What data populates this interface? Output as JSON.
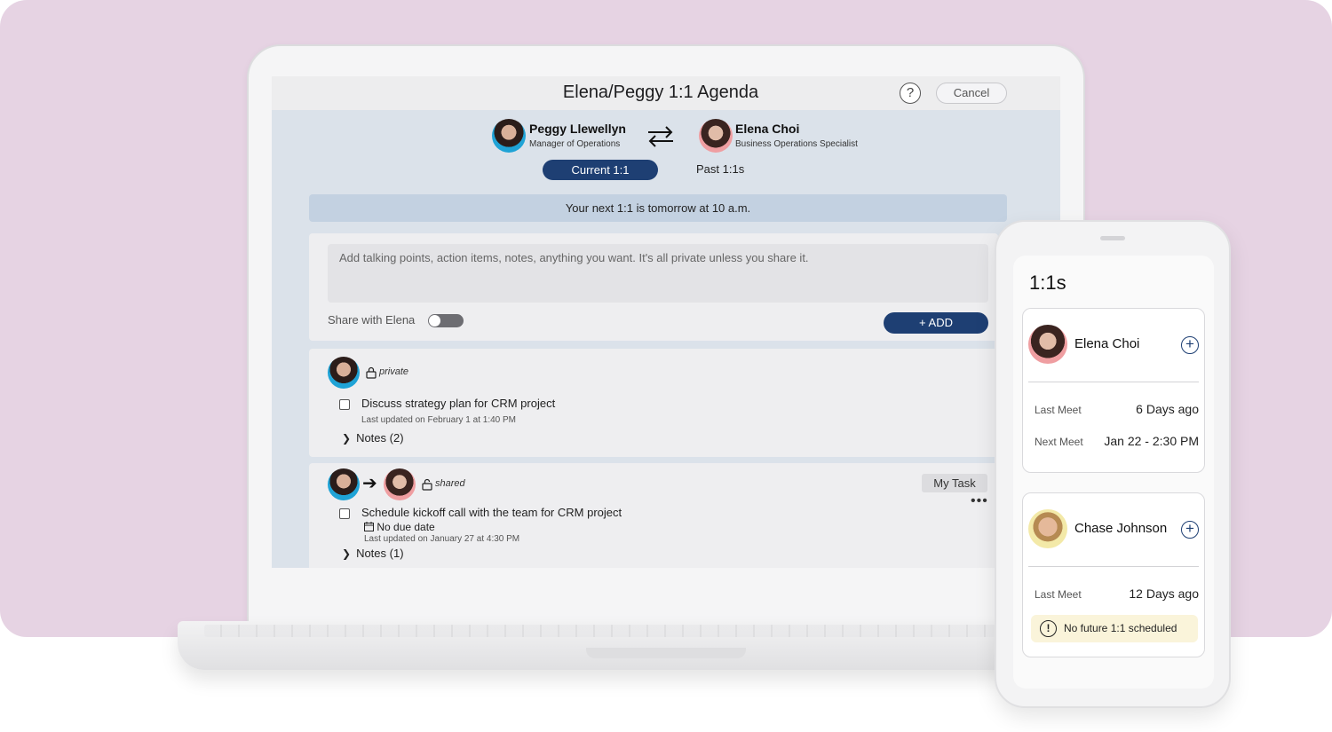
{
  "app": {
    "title": "Elena/Peggy 1:1 Agenda",
    "help_label": "?",
    "cancel_label": "Cancel"
  },
  "participants": {
    "manager": {
      "name": "Peggy Llewellyn",
      "role": "Manager of Operations"
    },
    "report": {
      "name": "Elena Choi",
      "role": "Business Operations Specialist"
    }
  },
  "tabs": {
    "current": "Current 1:1",
    "past": "Past 1:1s"
  },
  "banner": "Your next 1:1 is tomorrow at 10 a.m.",
  "composer": {
    "placeholder": "Add talking points, action items, notes, anything you want. It's all private unless you share it.",
    "share_label": "Share with Elena",
    "share_enabled": false,
    "add_label": "+ ADD"
  },
  "items": [
    {
      "visibility": "private",
      "text": "Discuss strategy plan for CRM project",
      "updated": "Last updated on February 1 at 1:40 PM",
      "notes": "Notes (2)"
    },
    {
      "visibility": "shared",
      "tag": "My Task",
      "text": "Schedule kickoff call with the team for CRM project",
      "due": "No due date",
      "updated": "Last updated on January 27 at 4:30 PM",
      "notes": "Notes (1)",
      "more": "•••"
    }
  ],
  "phone": {
    "title": "1:1s",
    "cards": [
      {
        "name": "Elena Choi",
        "last_label": "Last Meet",
        "last_value": "6 Days ago",
        "next_label": "Next Meet",
        "next_value": "Jan 22 - 2:30 PM"
      },
      {
        "name": "Chase Johnson",
        "last_label": "Last Meet",
        "last_value": "12 Days ago",
        "warning": "No future 1:1 scheduled",
        "warning_icon": "!"
      }
    ]
  },
  "colors": {
    "accent": "#1e3f73",
    "background": "#e6d3e3",
    "banner": "#c3d1e1",
    "warning": "#faf4da"
  },
  "icons": [
    "help-icon",
    "swap-arrows-icon",
    "lock-icon",
    "checkbox-icon",
    "chevron-right-icon",
    "arrow-right-icon",
    "calendar-icon",
    "more-icon",
    "plus-circle-icon",
    "warning-icon"
  ]
}
